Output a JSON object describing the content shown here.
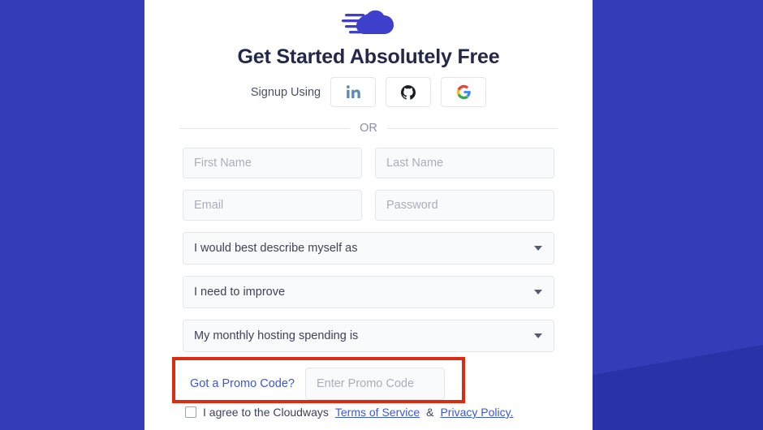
{
  "theme": {
    "panel_blue": "#353CB8",
    "wedge_blue": "#2A32A8",
    "heading_navy": "#232749",
    "link_blue": "#3b57d4",
    "annotation_red": "#DB2B10",
    "field_bg": "#f9fafb"
  },
  "logo": {
    "name": "cloudways-cloud-logo",
    "alt": "Cloudways"
  },
  "heading": "Get Started Absolutely Free",
  "social": {
    "label": "Signup Using",
    "buttons": [
      {
        "name": "linkedin-icon",
        "title": "LinkedIn"
      },
      {
        "name": "github-icon",
        "title": "GitHub"
      },
      {
        "name": "google-icon",
        "title": "Google"
      }
    ]
  },
  "divider": {
    "text": "OR"
  },
  "form": {
    "first_name_placeholder": "First Name",
    "first_name_value": "",
    "last_name_placeholder": "Last Name",
    "last_name_value": "",
    "email_placeholder": "Email",
    "email_value": "",
    "password_placeholder": "Password",
    "password_value": "",
    "selects": [
      {
        "name": "describe-myself-select",
        "value": "I would best describe myself as"
      },
      {
        "name": "need-to-improve-select",
        "value": "I need to improve"
      },
      {
        "name": "monthly-spending-select",
        "value": "My monthly hosting spending is"
      }
    ]
  },
  "promo": {
    "link_label": "Got a Promo Code?",
    "input_placeholder": "Enter Promo Code",
    "input_value": ""
  },
  "terms": {
    "prefix": "I agree to the Cloudways",
    "terms_link": "Terms of Service",
    "separator": "&",
    "privacy_link": "Privacy Policy."
  }
}
